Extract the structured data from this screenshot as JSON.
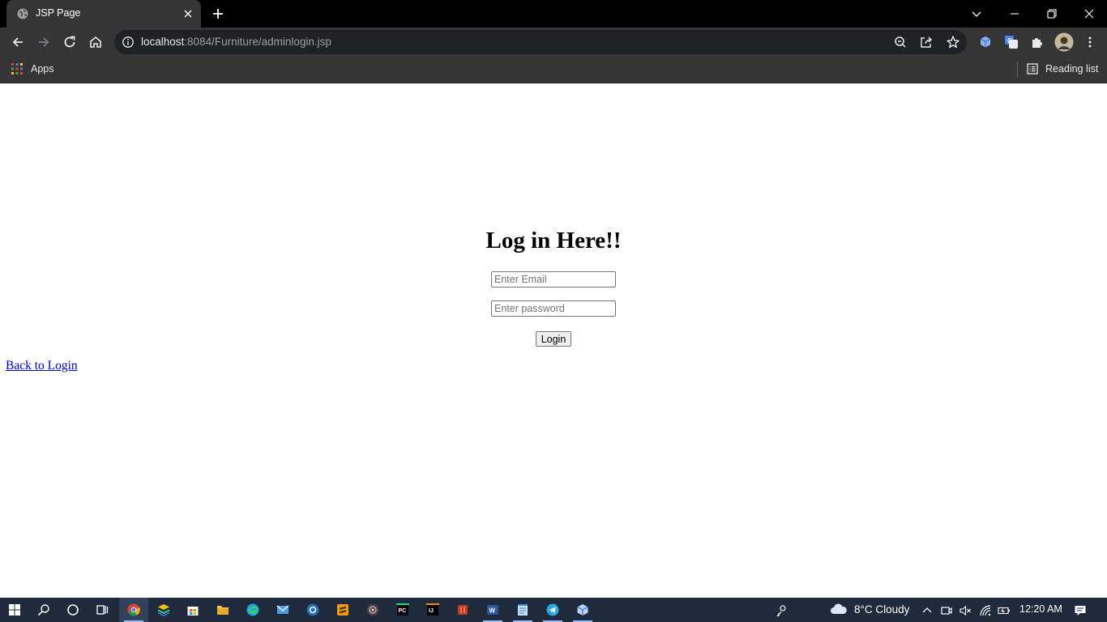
{
  "browser": {
    "tab_title": "JSP Page",
    "url_host": "localhost",
    "url_rest": ":8084/Furniture/adminlogin.jsp",
    "bookmarks": {
      "apps_label": "Apps",
      "reading_list_label": "Reading list"
    }
  },
  "page": {
    "heading": "Log in Here!!",
    "email_placeholder": "Enter Email",
    "password_placeholder": "Enter password",
    "login_button": "Login",
    "back_link": "Back to Login"
  },
  "taskbar": {
    "weather": "8°C  Cloudy",
    "time": "12:20 AM",
    "apps": [
      "start-icon",
      "search-icon",
      "cortana-icon",
      "task-view-icon",
      "chrome-icon",
      "bluestacks-icon",
      "store-icon",
      "file-explorer-icon",
      "edge-icon",
      "mail-icon",
      "app-icon",
      "sublime-text-icon",
      "obs-icon",
      "pycharm-icon",
      "intellij-icon",
      "app-icon",
      "word-icon",
      "notepad-icon",
      "telegram-icon",
      "virtualbox-icon"
    ]
  },
  "colors": {
    "chrome_dark": "#353535",
    "tabstrip": "#000000",
    "link": "#0000ee",
    "taskbar": "#1f2a3d",
    "accent": "#8fb8ff"
  }
}
